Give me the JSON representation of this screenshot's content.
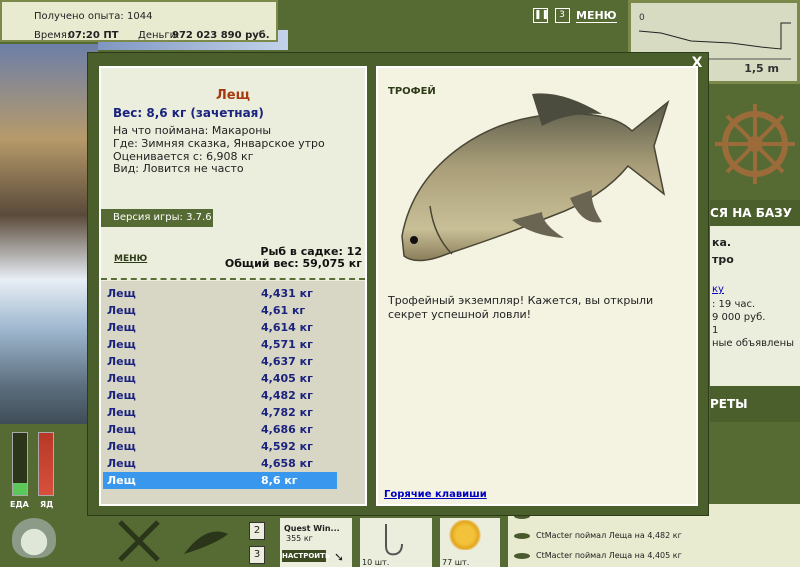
{
  "topbar": {
    "exp_label": "Получено опыта:",
    "exp_value": "1044",
    "time_label": "Время:",
    "time_value": "07:20 ПТ",
    "money_label": "Деньги:",
    "money_value": "972 023 890 руб."
  },
  "top_icons": {
    "menu_label": "МЕНЮ",
    "num_btn": "3"
  },
  "depth": {
    "value": "1,5 m",
    "marker": "0"
  },
  "right_panel": {
    "go_base": "СЯ НА БАЗУ",
    "info_lines": [
      "ка.",
      "тро",
      "",
      "ку",
      ": 19 час.",
      "9 000 руб.",
      "1",
      "ные объявлены"
    ],
    "secrets": "РЕТЫ"
  },
  "gauges": {
    "food_label": "ЕДА",
    "misc_label": "ЯД"
  },
  "quest": {
    "title": "Quest Win...",
    "weight": "355 кг",
    "button": "НАСТРОИТЬ"
  },
  "slots": {
    "num2": "2",
    "num3": "3",
    "hook_count": "10 шт.",
    "corn_count": "77 шт."
  },
  "chat": {
    "lines": [
      "CtMacter поймал Леща на 4,482 кг",
      "CtMacter поймал Леща на 4,405 кг"
    ]
  },
  "dialog": {
    "close": "X",
    "fish_name": "Лещ",
    "fish_weight": "Вес: 8,6 кг (зачетная)",
    "bait": "На что поймана: Макароны",
    "place": "Где: Зимняя сказка, Январское утро",
    "value": "Оценивается с: 6,908 кг",
    "kind": "Вид: Ловится не часто",
    "version_label": "Версия игры:",
    "version_value": "3.7.6",
    "menu_label": "МЕНЮ",
    "net_count": "Рыб в садке: 12",
    "net_weight": "Общий вес: 59,075 кг",
    "catches": [
      {
        "name": "Лещ",
        "weight": "4,431 кг"
      },
      {
        "name": "Лещ",
        "weight": "4,61 кг"
      },
      {
        "name": "Лещ",
        "weight": "4,614 кг"
      },
      {
        "name": "Лещ",
        "weight": "4,571 кг"
      },
      {
        "name": "Лещ",
        "weight": "4,637 кг"
      },
      {
        "name": "Лещ",
        "weight": "4,405 кг"
      },
      {
        "name": "Лещ",
        "weight": "4,482 кг"
      },
      {
        "name": "Лещ",
        "weight": "4,782 кг"
      },
      {
        "name": "Лещ",
        "weight": "4,686 кг"
      },
      {
        "name": "Лещ",
        "weight": "4,592 кг"
      },
      {
        "name": "Лещ",
        "weight": "4,658 кг"
      },
      {
        "name": "Лещ",
        "weight": "8,6 кг"
      }
    ],
    "trophy_label": "ТРОФЕЙ",
    "trophy_text": "Трофейный экземпляр! Кажется, вы открыли секрет успешной ловли!",
    "hotkeys": "Горячие клавиши"
  }
}
